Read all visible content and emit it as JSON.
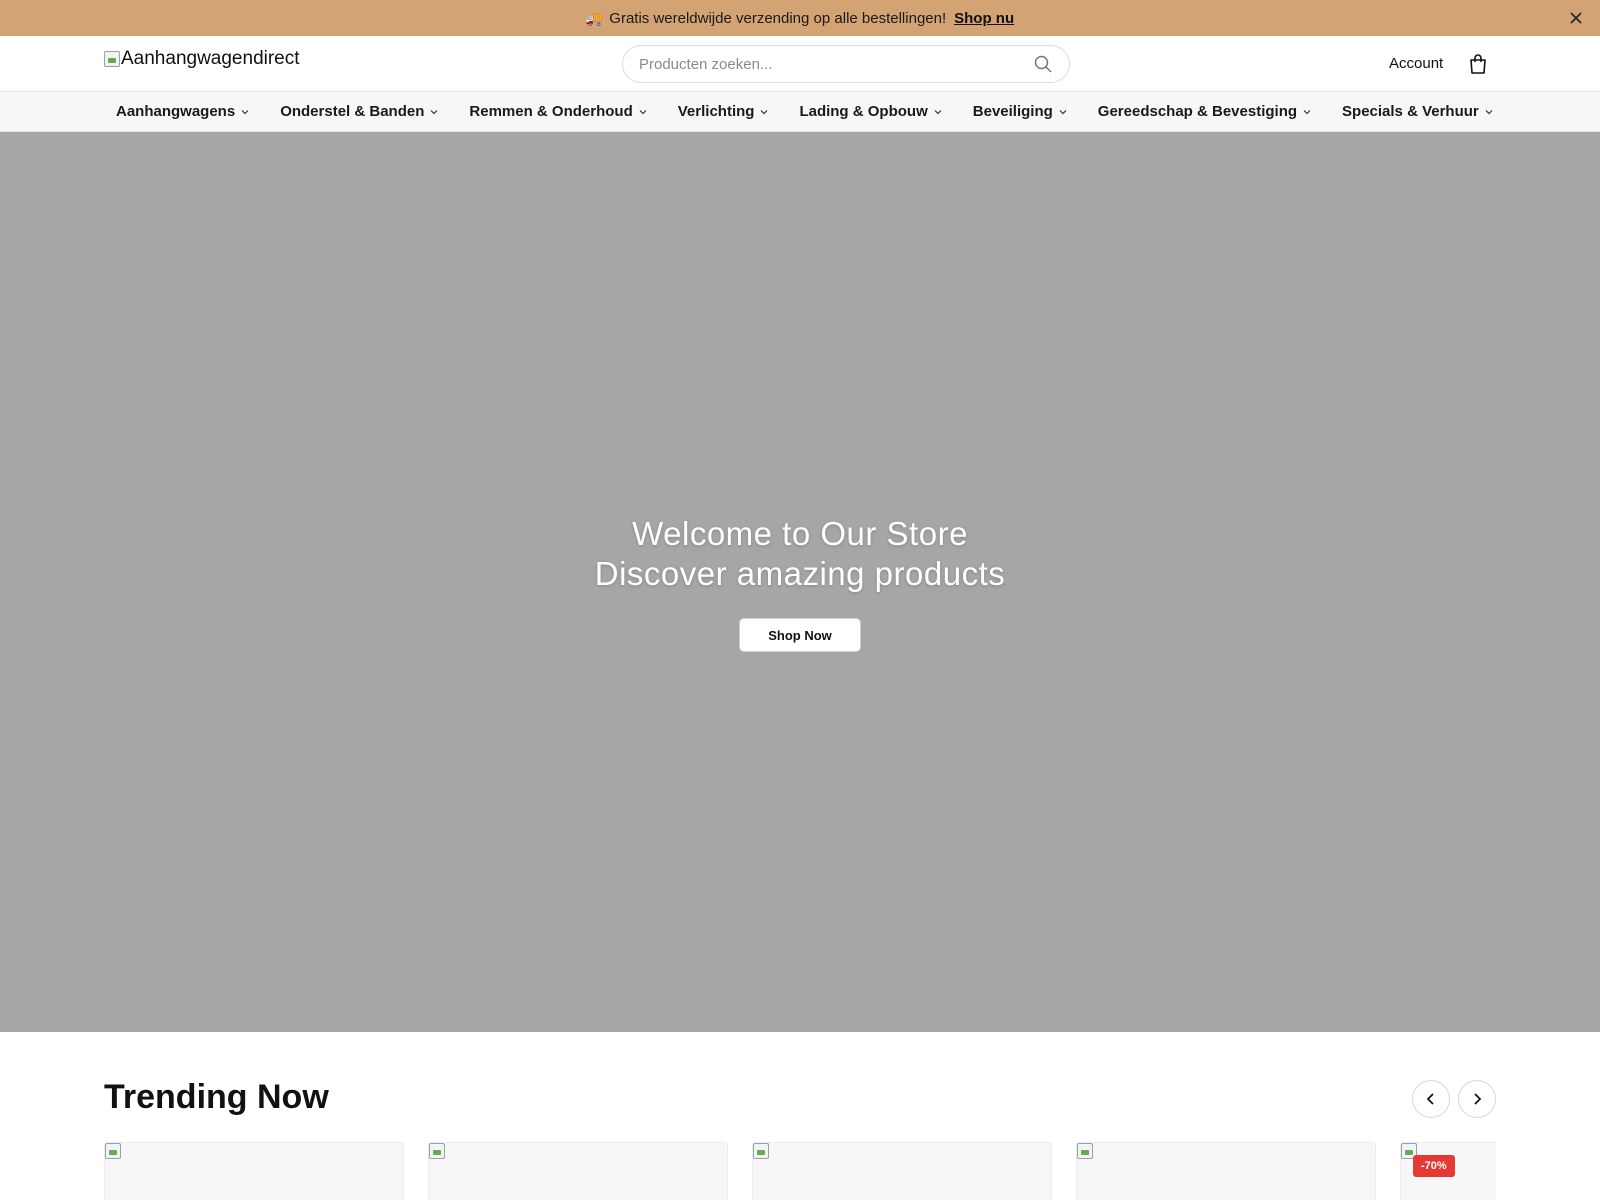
{
  "announcement": {
    "text": "Gratis wereldwijde verzending op alle bestellingen!",
    "link_label": "Shop nu",
    "background": "#d4a373"
  },
  "header": {
    "logo_alt": "Aanhangwagendirect",
    "search_placeholder": "Producten zoeken...",
    "account_label": "Account"
  },
  "nav": {
    "items": [
      {
        "label": "Aanhangwagens"
      },
      {
        "label": "Onderstel & Banden"
      },
      {
        "label": "Remmen & Onderhoud"
      },
      {
        "label": "Verlichting"
      },
      {
        "label": "Lading & Opbouw"
      },
      {
        "label": "Beveiliging"
      },
      {
        "label": "Gereedschap & Bevestiging"
      },
      {
        "label": "Specials & Verhuur"
      }
    ]
  },
  "hero": {
    "title_line1": "Welcome to Our Store",
    "title_line2": "Discover amazing products",
    "button_label": "Shop Now",
    "background": "#a5a6a8"
  },
  "trending": {
    "title": "Trending Now",
    "products": [
      {
        "badge": ""
      },
      {
        "badge": ""
      },
      {
        "badge": ""
      },
      {
        "badge": ""
      },
      {
        "badge": "-70%"
      }
    ]
  },
  "colors": {
    "accent": "#d4a373",
    "sale_badge": "#e53935"
  }
}
